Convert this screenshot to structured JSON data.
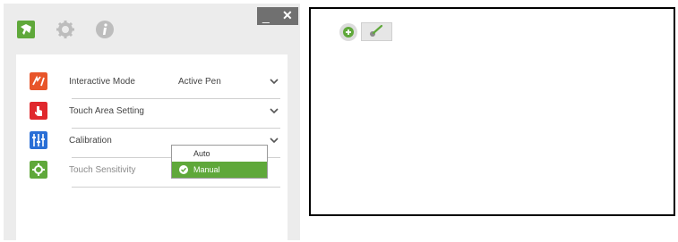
{
  "window": {
    "header_icons": [
      "home-icon",
      "gear-icon",
      "info-icon"
    ],
    "controls": {
      "minimize": "_",
      "close": "✕"
    }
  },
  "settings": {
    "rows": [
      {
        "label": "Interactive Mode",
        "value": "Active Pen",
        "icon": "interactive-mode-icon",
        "color": "#e8552a"
      },
      {
        "label": "Touch Area Setting",
        "value": "",
        "icon": "touch-area-icon",
        "color": "#e0282d"
      },
      {
        "label": "Calibration",
        "value": "",
        "icon": "calibration-icon",
        "color": "#2a6fd6"
      },
      {
        "label": "Touch Sensitivity",
        "value": "",
        "icon": "touch-sensitivity-icon",
        "color": "#5fa83a"
      }
    ]
  },
  "calibration_dropdown": {
    "options": [
      "Auto",
      "Manual"
    ],
    "selected": "Manual"
  },
  "colors": {
    "accent_green": "#5fa83a",
    "window_bg": "#ececec",
    "control_bar": "#707070"
  },
  "canvas": {
    "tools": [
      "add-icon",
      "pen-icon"
    ]
  }
}
